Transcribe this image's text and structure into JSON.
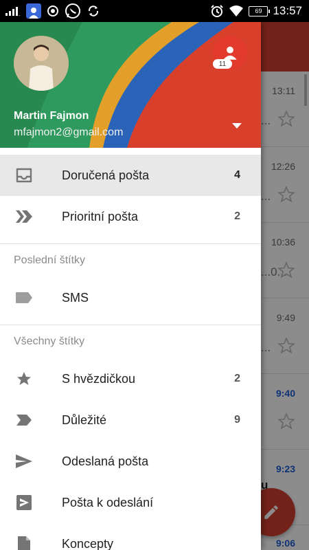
{
  "status_bar": {
    "time": "13:57",
    "battery": "69"
  },
  "account": {
    "name": "Martin Fajmon",
    "email": "mfajmon2@gmail.com",
    "other_accounts_badge": "11"
  },
  "menu": {
    "primary": [
      {
        "label": "Doručená pošta",
        "count": "4",
        "icon": "inbox-icon"
      },
      {
        "label": "Prioritní pošta",
        "count": "2",
        "icon": "priority-icon"
      }
    ],
    "recent_header": "Poslední štítky",
    "recent": [
      {
        "label": "SMS",
        "icon": "label-icon"
      }
    ],
    "all_header": "Všechny štítky",
    "all": [
      {
        "label": "S hvězdičkou",
        "count": "2",
        "icon": "star-icon"
      },
      {
        "label": "Důležité",
        "count": "9",
        "icon": "important-icon"
      },
      {
        "label": "Odeslaná pošta",
        "icon": "send-icon"
      },
      {
        "label": "Pošta k odeslání",
        "icon": "outbox-icon"
      },
      {
        "label": "Koncepty",
        "icon": "draft-icon"
      }
    ]
  },
  "background_list": {
    "times": [
      "13:11",
      "12:26",
      "10:36",
      "9:49",
      "9:40",
      "9:23",
      "9:06"
    ],
    "snippets": [
      "...",
      "...",
      "...0...",
      "...",
      "",
      "u",
      ""
    ]
  },
  "colors": {
    "accent": "#d23f31",
    "unread_time": "#1a5bd6"
  }
}
